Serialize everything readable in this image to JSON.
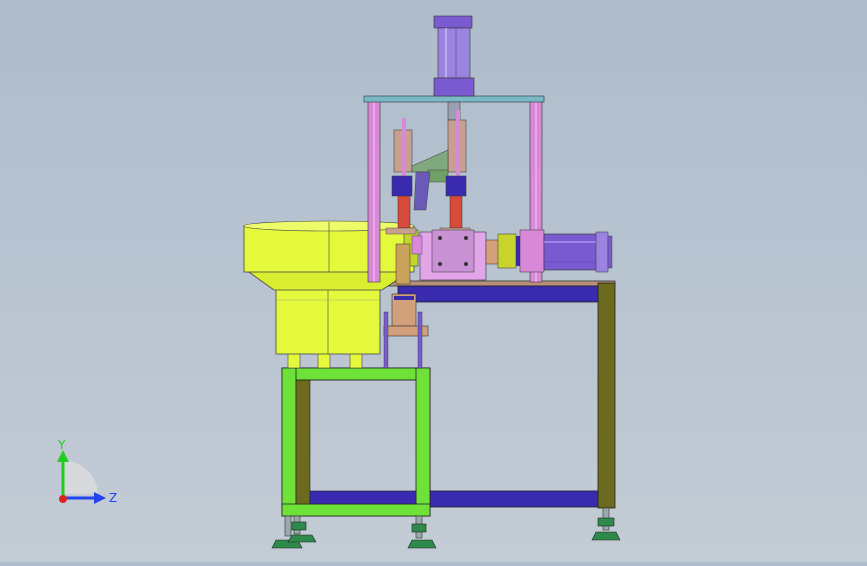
{
  "viewport": {
    "background_top": "#aebccb",
    "background_bottom": "#c4ccd5"
  },
  "triad": {
    "y_label": "Y",
    "z_label": "Z",
    "y_color": "#22cc22",
    "z_color": "#2244ee",
    "x_color": "#dd2222"
  },
  "colors": {
    "bowl": "#e4f83c",
    "frame_green": "#6fe23a",
    "frame_olive": "#6b6a1e",
    "rail_blue": "#3a2ab0",
    "post_pink": "#d88ad8",
    "cylinder_purple": "#7a5ad0",
    "block_pink": "#e2a6e8",
    "plate_brown": "#d2a07a",
    "foot_green": "#2e8a4a"
  }
}
